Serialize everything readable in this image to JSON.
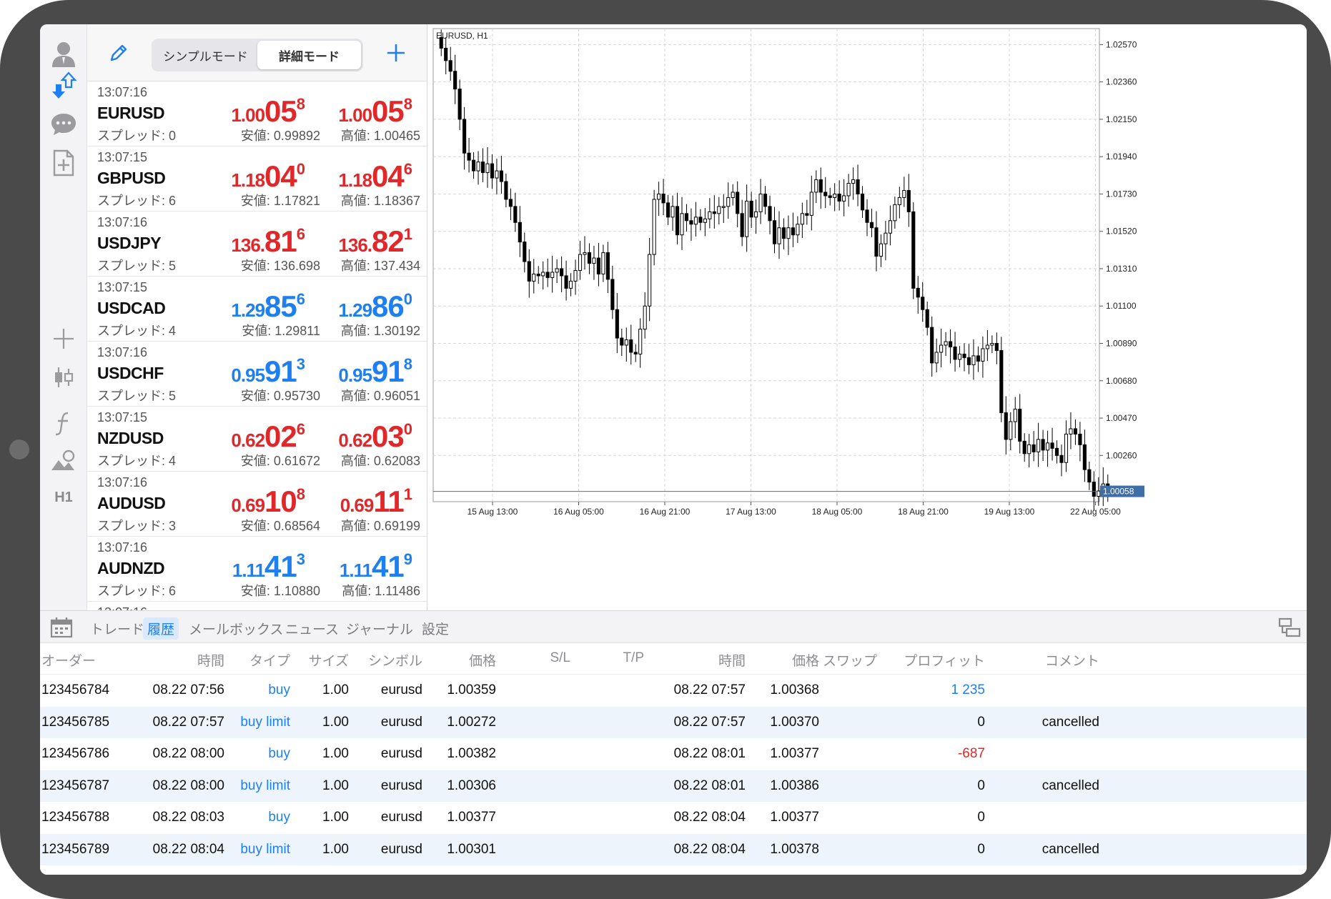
{
  "mode_toggle": {
    "simple": "シンプルモード",
    "detailed": "詳細モード",
    "active": "detailed"
  },
  "rail": {
    "timeframe": "H1"
  },
  "quotes": [
    {
      "time": "13:07:16",
      "symbol": "EURUSD",
      "spread": "スプレッド: 0",
      "bid": {
        "pre": "1.00",
        "big": "05",
        "pip": "8"
      },
      "ask": {
        "pre": "1.00",
        "big": "05",
        "pip": "8"
      },
      "color": "red",
      "low": "安値: 0.99892",
      "high": "高値: 1.00465"
    },
    {
      "time": "13:07:15",
      "symbol": "GBPUSD",
      "spread": "スプレッド: 6",
      "bid": {
        "pre": "1.18",
        "big": "04",
        "pip": "0"
      },
      "ask": {
        "pre": "1.18",
        "big": "04",
        "pip": "6"
      },
      "color": "red",
      "low": "安値: 1.17821",
      "high": "高値: 1.18367"
    },
    {
      "time": "13:07:16",
      "symbol": "USDJPY",
      "spread": "スプレッド: 5",
      "bid": {
        "pre": "136.",
        "big": "81",
        "pip": "6"
      },
      "ask": {
        "pre": "136.",
        "big": "82",
        "pip": "1"
      },
      "color": "red",
      "low": "安値: 136.698",
      "high": "高値: 137.434"
    },
    {
      "time": "13:07:15",
      "symbol": "USDCAD",
      "spread": "スプレッド: 4",
      "bid": {
        "pre": "1.29",
        "big": "85",
        "pip": "6"
      },
      "ask": {
        "pre": "1.29",
        "big": "86",
        "pip": "0"
      },
      "color": "blue",
      "low": "安値: 1.29811",
      "high": "高値: 1.30192"
    },
    {
      "time": "13:07:16",
      "symbol": "USDCHF",
      "spread": "スプレッド: 5",
      "bid": {
        "pre": "0.95",
        "big": "91",
        "pip": "3"
      },
      "ask": {
        "pre": "0.95",
        "big": "91",
        "pip": "8"
      },
      "color": "blue",
      "low": "安値: 0.95730",
      "high": "高値: 0.96051"
    },
    {
      "time": "13:07:15",
      "symbol": "NZDUSD",
      "spread": "スプレッド: 4",
      "bid": {
        "pre": "0.62",
        "big": "02",
        "pip": "6"
      },
      "ask": {
        "pre": "0.62",
        "big": "03",
        "pip": "0"
      },
      "color": "red",
      "low": "安値: 0.61672",
      "high": "高値: 0.62083"
    },
    {
      "time": "13:07:16",
      "symbol": "AUDUSD",
      "spread": "スプレッド: 3",
      "bid": {
        "pre": "0.69",
        "big": "10",
        "pip": "8"
      },
      "ask": {
        "pre": "0.69",
        "big": "11",
        "pip": "1"
      },
      "color": "red",
      "low": "安値: 0.68564",
      "high": "高値: 0.69199"
    },
    {
      "time": "13:07:16",
      "symbol": "AUDNZD",
      "spread": "スプレッド: 6",
      "bid": {
        "pre": "1.11",
        "big": "41",
        "pip": "3"
      },
      "ask": {
        "pre": "1.11",
        "big": "41",
        "pip": "9"
      },
      "color": "blue",
      "low": "安値: 1.10880",
      "high": "高値: 1.11486"
    }
  ],
  "quote_partial_time": "13:07:16",
  "chart_data": {
    "type": "candlestick",
    "title": "EURUSD, H1",
    "ylim": [
      1.0,
      1.0266
    ],
    "y_ticks": [
      "1.02570",
      "1.02360",
      "1.02150",
      "1.01940",
      "1.01730",
      "1.01520",
      "1.01310",
      "1.01100",
      "1.00890",
      "1.00680",
      "1.00470",
      "1.00260"
    ],
    "x_ticks": [
      "15 Aug 13:00",
      "16 Aug 05:00",
      "16 Aug 21:00",
      "17 Aug 13:00",
      "18 Aug 05:00",
      "18 Aug 21:00",
      "19 Aug 13:00",
      "22 Aug 05:00"
    ],
    "current_price": "1.00058",
    "closes": [
      1.0255,
      1.0248,
      1.0242,
      1.0232,
      1.0215,
      1.0196,
      1.0192,
      1.0186,
      1.0191,
      1.0185,
      1.019,
      1.0182,
      1.0186,
      1.018,
      1.017,
      1.0166,
      1.0157,
      1.0146,
      1.0135,
      1.0124,
      1.0128,
      1.0127,
      1.0129,
      1.0126,
      1.0129,
      1.0131,
      1.0127,
      1.012,
      1.0124,
      1.013,
      1.0139,
      1.014,
      1.0134,
      1.0137,
      1.0128,
      1.014,
      1.0125,
      1.0108,
      1.0092,
      1.0088,
      1.0091,
      1.0084,
      1.0083,
      1.0097,
      1.011,
      1.0139,
      1.017,
      1.0173,
      1.0168,
      1.016,
      1.0166,
      1.015,
      1.0162,
      1.0158,
      1.0156,
      1.016,
      1.0157,
      1.0159,
      1.0163,
      1.0162,
      1.0166,
      1.0166,
      1.0171,
      1.0174,
      1.0162,
      1.0149,
      1.0169,
      1.016,
      1.0163,
      1.0173,
      1.0166,
      1.0158,
      1.0145,
      1.0154,
      1.0148,
      1.0154,
      1.015,
      1.0156,
      1.0162,
      1.0161,
      1.0174,
      1.0181,
      1.0174,
      1.0172,
      1.0171,
      1.0173,
      1.0169,
      1.0172,
      1.0179,
      1.0181,
      1.0173,
      1.0164,
      1.0157,
      1.0154,
      1.0138,
      1.0145,
      1.0151,
      1.0158,
      1.0167,
      1.0171,
      1.0175,
      1.0163,
      1.012,
      1.0115,
      1.0108,
      1.0098,
      1.0078,
      1.0084,
      1.0088,
      1.009,
      1.0087,
      1.008,
      1.0083,
      1.0081,
      1.0077,
      1.0082,
      1.0079,
      1.0086,
      1.0088,
      1.0089,
      1.0085,
      1.005,
      1.0035,
      1.0045,
      1.0052,
      1.0034,
      1.0027,
      1.0032,
      1.0028,
      1.0035,
      1.0029,
      1.0033,
      1.003,
      1.0026,
      1.0022,
      1.0038,
      1.0041,
      1.0038,
      1.0032,
      1.0018,
      1.0011,
      1.0003,
      1.0006,
      1.001,
      1.0006
    ]
  },
  "bottom_tabs": [
    "トレード",
    "履歴",
    "メールボックス",
    "ニュース",
    "ジャーナル",
    "設定"
  ],
  "active_tab": "履歴",
  "history": {
    "headers": [
      "オーダー",
      "時間",
      "タイプ",
      "サイズ",
      "シンボル",
      "価格",
      "S/L",
      "T/P",
      "時間",
      "価格",
      "スワップ",
      "プロフィット",
      "コメント"
    ],
    "rows": [
      {
        "order": "123456784",
        "open_time": "08.22 07:56",
        "type": "buy",
        "size": "1.00",
        "symbol": "eurusd",
        "price": "1.00359",
        "close_time": "08.22 07:57",
        "close_price": "1.00368",
        "profit": "1 235",
        "profit_color": "blue",
        "comment": ""
      },
      {
        "order": "123456785",
        "open_time": "08.22 07:57",
        "type": "buy limit",
        "size": "1.00",
        "symbol": "eurusd",
        "price": "1.00272",
        "close_time": "08.22 07:57",
        "close_price": "1.00370",
        "profit": "0",
        "profit_color": "black",
        "comment": "cancelled"
      },
      {
        "order": "123456786",
        "open_time": "08.22 08:00",
        "type": "buy",
        "size": "1.00",
        "symbol": "eurusd",
        "price": "1.00382",
        "close_time": "08.22 08:01",
        "close_price": "1.00377",
        "profit": "-687",
        "profit_color": "red",
        "comment": ""
      },
      {
        "order": "123456787",
        "open_time": "08.22 08:00",
        "type": "buy limit",
        "size": "1.00",
        "symbol": "eurusd",
        "price": "1.00306",
        "close_time": "08.22 08:01",
        "close_price": "1.00386",
        "profit": "0",
        "profit_color": "black",
        "comment": "cancelled"
      },
      {
        "order": "123456788",
        "open_time": "08.22 08:03",
        "type": "buy",
        "size": "1.00",
        "symbol": "eurusd",
        "price": "1.00377",
        "close_time": "08.22 08:04",
        "close_price": "1.00377",
        "profit": "0",
        "profit_color": "black",
        "comment": ""
      },
      {
        "order": "123456789",
        "open_time": "08.22 08:04",
        "type": "buy limit",
        "size": "1.00",
        "symbol": "eurusd",
        "price": "1.00301",
        "close_time": "08.22 08:04",
        "close_price": "1.00378",
        "profit": "0",
        "profit_color": "black",
        "comment": "cancelled"
      }
    ]
  }
}
